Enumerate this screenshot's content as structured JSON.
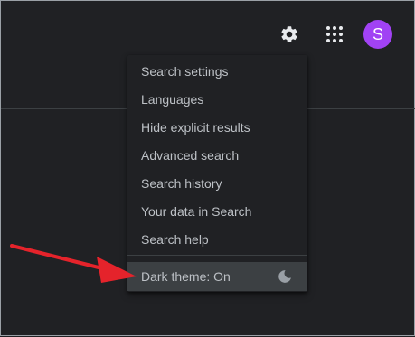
{
  "header": {
    "avatar_letter": "S",
    "avatar_color": "#a142f4",
    "settings_icon": "gear-icon",
    "apps_icon": "apps-grid-icon"
  },
  "menu": {
    "items": [
      {
        "label": "Search settings"
      },
      {
        "label": "Languages"
      },
      {
        "label": "Hide explicit results"
      },
      {
        "label": "Advanced search"
      },
      {
        "label": "Search history"
      },
      {
        "label": "Your data in Search"
      },
      {
        "label": "Search help"
      }
    ],
    "dark_theme_label": "Dark theme: On",
    "dark_theme_icon": "moon-icon"
  },
  "annotation": {
    "arrow_color": "#e5232b",
    "arrow_icon": "arrow-icon"
  }
}
